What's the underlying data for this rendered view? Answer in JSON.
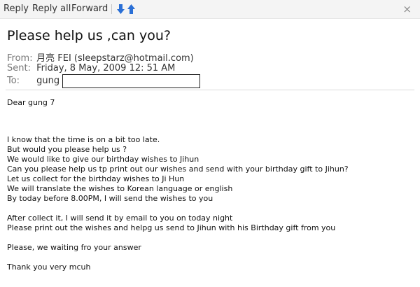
{
  "toolbar": {
    "reply_label": "Reply",
    "reply_all_label": "Reply all",
    "forward_label": "Forward",
    "close_glyph": "×",
    "icons": [
      "arrow-down-icon",
      "arrow-up-icon"
    ],
    "arrow_color": "#2a6fd6"
  },
  "message": {
    "subject": "Please help us ,can you?",
    "from_label": "From:",
    "from_value": "月亮 FEI (sleepstarz@hotmail.com)",
    "sent_label": "Sent:",
    "sent_value": "Friday, 8 May, 2009 12: 51 AM",
    "to_label": "To:",
    "to_value": "gung 7",
    "body": {
      "greeting": "Dear gung 7",
      "p1": [
        "I know that the time is on a bit too late.",
        "But would you  please help us ?",
        "We would  like to give our birthday wishes to Jihun",
        "Can you please help us tp print out our wishes and send with your birthday gift to Jihun?",
        "Let us collect for the birthday wishes to Ji Hun",
        "We will translate the wishes to Korean language or english",
        "By today before 8.00PM, I will send the wishes to you"
      ],
      "p2": [
        "After collect it, I will send it by email to you on today night",
        "Please print out the wishes and helpg   us send to Jihun with his Birthday gift from you"
      ],
      "p3": "Please, we waiting fro your answer",
      "p4": "Thank you very mcuh"
    }
  }
}
